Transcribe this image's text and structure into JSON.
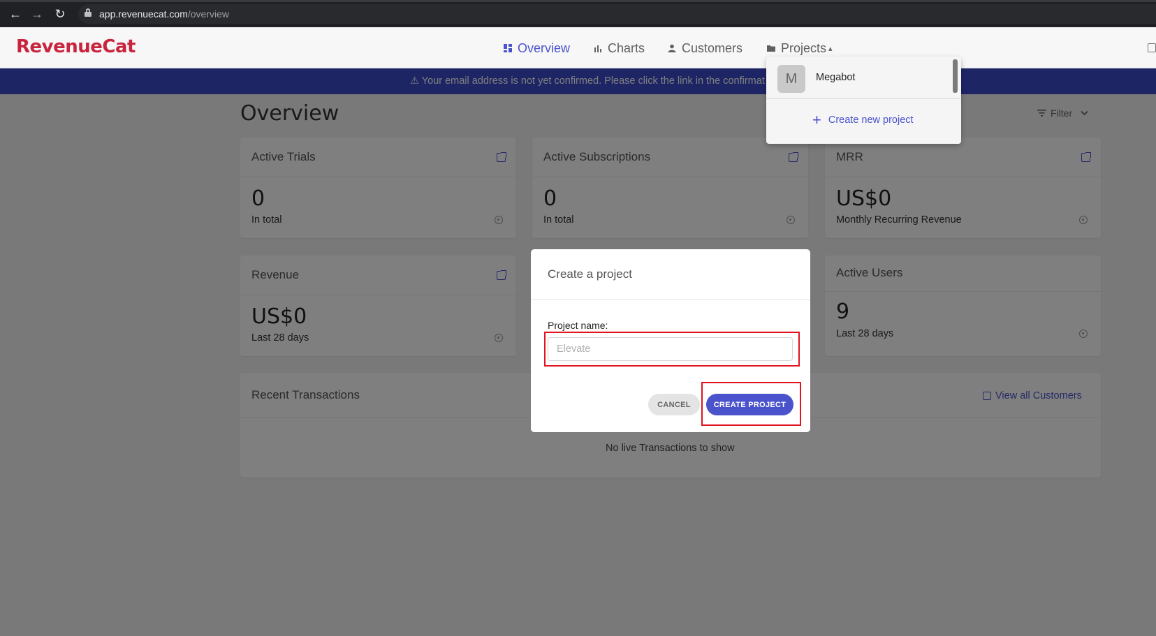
{
  "browser": {
    "url_domain": "app.revenuecat.com",
    "url_path": "/overview"
  },
  "header": {
    "logo": "RevenueCat",
    "nav": [
      {
        "label": "Overview",
        "icon": "dashboard-icon",
        "active": true
      },
      {
        "label": "Charts",
        "icon": "bar-chart-icon",
        "active": false
      },
      {
        "label": "Customers",
        "icon": "person-icon",
        "active": false
      },
      {
        "label": "Projects",
        "icon": "folder-icon",
        "active": false
      }
    ],
    "projects_caret": "▴"
  },
  "banner": {
    "text": "⚠ Your email address is not yet confirmed. Please click the link in the confirmat"
  },
  "page": {
    "title": "Overview",
    "filter_label": "Filter"
  },
  "cards": {
    "active_trials": {
      "title": "Active Trials",
      "value": "0",
      "sub": "In total"
    },
    "active_subscriptions": {
      "title": "Active Subscriptions",
      "value": "0",
      "sub": "In total"
    },
    "mrr": {
      "title": "MRR",
      "value": "US$0",
      "sub": "Monthly Recurring Revenue"
    },
    "revenue": {
      "title": "Revenue",
      "value": "US$0",
      "sub": "Last 28 days"
    },
    "active_users": {
      "title": "Active Users",
      "value": "9",
      "sub": "Last 28 days"
    }
  },
  "transactions": {
    "title": "Recent Transactions",
    "view_all": "View all Customers",
    "empty": "No live Transactions to show"
  },
  "projects_dropdown": {
    "project_initial": "M",
    "project_name": "Megabot",
    "create_label": "Create new project"
  },
  "modal": {
    "title": "Create a project",
    "field_label": "Project name:",
    "input_placeholder": "Elevate",
    "input_value": "",
    "cancel_label": "CANCEL",
    "create_label": "CREATE PROJECT"
  },
  "colors": {
    "brand_red": "#c9243d",
    "accent_blue": "#4a52cc",
    "banner_blue": "#3d4acb",
    "highlight_red": "#e0131f"
  }
}
